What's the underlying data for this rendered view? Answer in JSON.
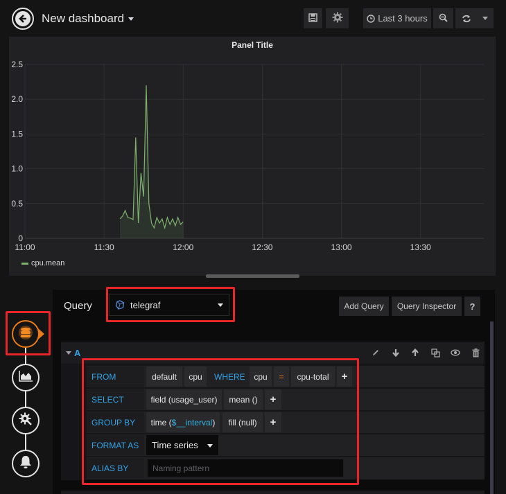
{
  "navbar": {
    "title": "New dashboard",
    "time_range_label": "Last 3 hours",
    "icons": [
      "back-arrow-icon",
      "save-icon",
      "gear-icon",
      "clock-icon",
      "zoom-out-icon",
      "refresh-icon",
      "caret-down-icon"
    ]
  },
  "panel": {
    "title": "Panel Title"
  },
  "chart_data": {
    "type": "line",
    "title": "Panel Title",
    "xlabel": "",
    "ylabel": "",
    "x_ticks": [
      "11:00",
      "11:30",
      "12:00",
      "12:30",
      "13:00",
      "13:30"
    ],
    "y_ticks": [
      "0",
      "0.5",
      "1.0",
      "1.5",
      "2.0",
      "2.5"
    ],
    "ylim": [
      0,
      2.5
    ],
    "xlim_minutes": [
      0,
      174
    ],
    "grid": true,
    "legend_position": "bottom-left",
    "series": [
      {
        "name": "cpu.mean",
        "color": "#7eb26d",
        "fill": true,
        "x_minutes": [
          36,
          37,
          38,
          39,
          40,
          41,
          42,
          43,
          44,
          45,
          46,
          47,
          48,
          49,
          50,
          51,
          52,
          53,
          54,
          55,
          56,
          57,
          58,
          59,
          60
        ],
        "values": [
          0.28,
          0.32,
          0.4,
          0.3,
          0.29,
          0.27,
          1.45,
          0.22,
          0.94,
          0.6,
          2.2,
          0.5,
          0.22,
          0.15,
          0.3,
          0.22,
          0.28,
          0.15,
          0.3,
          0.2,
          0.28,
          0.18,
          0.3,
          0.2,
          0.24
        ]
      }
    ],
    "legend": [
      "cpu.mean"
    ]
  },
  "editor": {
    "query_label": "Query",
    "datasource": "telegraf",
    "add_query_label": "Add Query",
    "query_inspector_label": "Query Inspector",
    "help_label": "?",
    "row_ref": "A",
    "sidebar_icons": [
      "queries-icon",
      "visualization-icon",
      "general-settings-icon",
      "alert-bell-icon"
    ],
    "query": {
      "from_kw": "FROM",
      "from_policy": "default",
      "from_measurement": "cpu",
      "where_kw": "WHERE",
      "where_key": "cpu",
      "where_op": "=",
      "where_value": "cpu-total",
      "select_kw": "SELECT",
      "select_field": "field (usage_user)",
      "select_fn": "mean ()",
      "group_kw": "GROUP BY",
      "group_time_prefix": "time (",
      "group_time_var": "$__interval",
      "group_time_suffix": ")",
      "group_fill": "fill (null)",
      "format_kw": "FORMAT AS",
      "format_value": "Time series",
      "alias_kw": "ALIAS BY",
      "alias_value": "",
      "alias_placeholder": "Naming pattern",
      "plus": "+"
    }
  }
}
